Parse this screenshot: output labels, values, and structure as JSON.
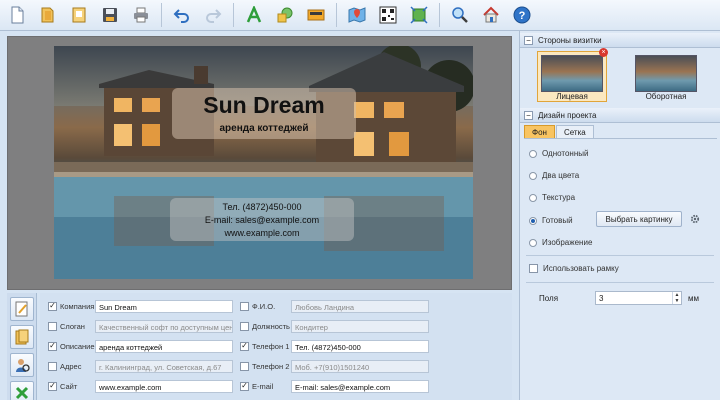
{
  "toolbar": {
    "buttons": [
      "new-file-icon",
      "open-folder-icon",
      "open-template-icon",
      "save-disk-icon",
      "print-icon",
      "undo-icon",
      "redo-icon",
      "text-tool-icon",
      "shapes-tool-icon",
      "image-tool-icon",
      "map-icon",
      "qr-code-icon",
      "fit-page-icon",
      "zoom-icon",
      "home-icon",
      "help-icon"
    ]
  },
  "card": {
    "title": "Sun Dream",
    "subtitle": "аренда коттеджей",
    "phone": "Тел. (4872)450-000",
    "email": "E-mail: sales@example.com",
    "site": "www.example.com"
  },
  "form": {
    "left": [
      {
        "label": "Компания",
        "value": "Sun Dream",
        "checked": true,
        "filled": true
      },
      {
        "label": "Слоган",
        "value": "Качественный софт по доступным ценам",
        "checked": false,
        "filled": false
      },
      {
        "label": "Описание",
        "value": "аренда коттеджей",
        "checked": true,
        "filled": true
      },
      {
        "label": "Адрес",
        "value": "г. Калининград, ул. Советская, д.67",
        "checked": false,
        "filled": false
      },
      {
        "label": "Сайт",
        "value": "www.example.com",
        "checked": true,
        "filled": true
      }
    ],
    "right": [
      {
        "label": "Ф.И.О.",
        "value": "Любовь Ландина",
        "checked": false,
        "filled": false
      },
      {
        "label": "Должность",
        "value": "Кондитер",
        "checked": false,
        "filled": false
      },
      {
        "label": "Телефон 1",
        "value": "Тел. (4872)450-000",
        "checked": true,
        "filled": true
      },
      {
        "label": "Телефон 2",
        "value": "Моб. +7(910)1501240",
        "checked": false,
        "filled": false
      },
      {
        "label": "E-mail",
        "value": "E-mail: sales@example.com",
        "checked": true,
        "filled": true
      }
    ]
  },
  "right_panel": {
    "sides_header": "Стороны визитки",
    "front_label": "Лицевая",
    "back_label": "Оборотная",
    "design_header": "Дизайн проекта",
    "tab_bg": "Фон",
    "tab_grid": "Сетка",
    "options": [
      "Однотонный",
      "Два цвета",
      "Текстура",
      "Готовый",
      "Изображение"
    ],
    "selected_option": "Готовый",
    "choose_picture": "Выбрать картинку",
    "use_frame": "Использовать рамку",
    "margins_label": "Поля",
    "margins_value": "3",
    "margins_unit": "мм"
  },
  "colors": {
    "accent_tab": "#f8c462",
    "selection": "#1f5fb0"
  }
}
